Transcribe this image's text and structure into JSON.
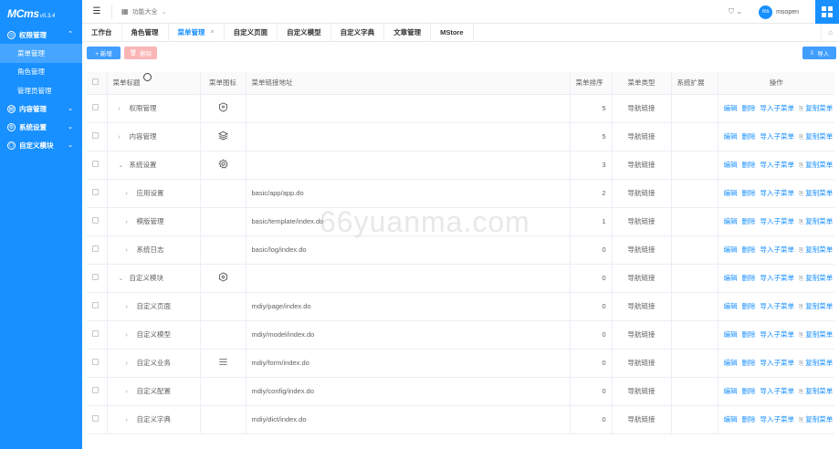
{
  "app": {
    "logo": "MCms",
    "version": "v5.3.4"
  },
  "sidebar": {
    "groups": [
      {
        "label": "权限管理",
        "expanded": true,
        "items": [
          {
            "label": "菜单管理",
            "active": true
          },
          {
            "label": "角色管理",
            "active": false
          },
          {
            "label": "管理员管理",
            "active": false
          }
        ]
      },
      {
        "label": "内容管理",
        "expanded": false,
        "items": []
      },
      {
        "label": "系统设置",
        "expanded": false,
        "items": []
      },
      {
        "label": "自定义模块",
        "expanded": false,
        "items": []
      }
    ]
  },
  "topbar": {
    "func_label": "功能大全",
    "username": "msopen",
    "avatar_text": "ms"
  },
  "tabs": [
    {
      "label": "工作台",
      "active": false
    },
    {
      "label": "角色管理",
      "active": false
    },
    {
      "label": "菜单管理",
      "active": true,
      "closable": true
    },
    {
      "label": "自定义页面",
      "active": false
    },
    {
      "label": "自定义模型",
      "active": false
    },
    {
      "label": "自定义字典",
      "active": false
    },
    {
      "label": "文章管理",
      "active": false
    },
    {
      "label": "MStore",
      "active": false
    }
  ],
  "toolbar": {
    "add_label": "+ 新增",
    "delete_label": "删除",
    "import_label": "导入"
  },
  "table": {
    "headers": [
      "菜单标题",
      "菜单图标",
      "菜单链接地址",
      "菜单排序",
      "菜单类型",
      "系统扩展",
      "操作"
    ],
    "rows": [
      {
        "title": "权限管理",
        "level": 0,
        "expand": "right",
        "icon": "shield-icon",
        "url": "",
        "sort": "5",
        "type": "导航链接",
        "ext": ""
      },
      {
        "title": "内容管理",
        "level": 0,
        "expand": "right",
        "icon": "layers-icon",
        "url": "",
        "sort": "5",
        "type": "导航链接",
        "ext": ""
      },
      {
        "title": "系统设置",
        "level": 0,
        "expand": "down",
        "icon": "gear-icon",
        "url": "",
        "sort": "3",
        "type": "导航链接",
        "ext": ""
      },
      {
        "title": "应用设置",
        "level": 1,
        "expand": "right",
        "icon": "",
        "url": "basic/app/app.do",
        "sort": "2",
        "type": "导航链接",
        "ext": ""
      },
      {
        "title": "模版管理",
        "level": 1,
        "expand": "right",
        "icon": "",
        "url": "basic/template/index.do",
        "sort": "1",
        "type": "导航链接",
        "ext": ""
      },
      {
        "title": "系统日志",
        "level": 1,
        "expand": "right",
        "icon": "",
        "url": "basic/log/index.do",
        "sort": "0",
        "type": "导航链接",
        "ext": ""
      },
      {
        "title": "自定义模块",
        "level": 0,
        "expand": "down",
        "icon": "hexagon-icon",
        "url": "",
        "sort": "0",
        "type": "导航链接",
        "ext": ""
      },
      {
        "title": "自定义页面",
        "level": 1,
        "expand": "right",
        "icon": "",
        "url": "mdiy/page/index.do",
        "sort": "0",
        "type": "导航链接",
        "ext": ""
      },
      {
        "title": "自定义模型",
        "level": 1,
        "expand": "right",
        "icon": "",
        "url": "mdiy/model/index.do",
        "sort": "0",
        "type": "导航链接",
        "ext": ""
      },
      {
        "title": "自定义业务",
        "level": 1,
        "expand": "right",
        "icon": "list-icon",
        "url": "mdiy/form/index.do",
        "sort": "0",
        "type": "导航链接",
        "ext": ""
      },
      {
        "title": "自定义配置",
        "level": 1,
        "expand": "right",
        "icon": "",
        "url": "mdiy/config/index.do",
        "sort": "0",
        "type": "导航链接",
        "ext": ""
      },
      {
        "title": "自定义字典",
        "level": 1,
        "expand": "right",
        "icon": "",
        "url": "mdiy/dict/index.do",
        "sort": "0",
        "type": "导航链接",
        "ext": ""
      }
    ],
    "actions": {
      "edit": "编辑",
      "delete": "删除",
      "import_sub": "导入子菜单",
      "copy": "复制菜单"
    }
  },
  "watermark": "66yuanma.com",
  "colors": {
    "primary": "#1890ff",
    "sidebar_active": "#46a6ff",
    "danger_disabled": "#fab6b6"
  }
}
